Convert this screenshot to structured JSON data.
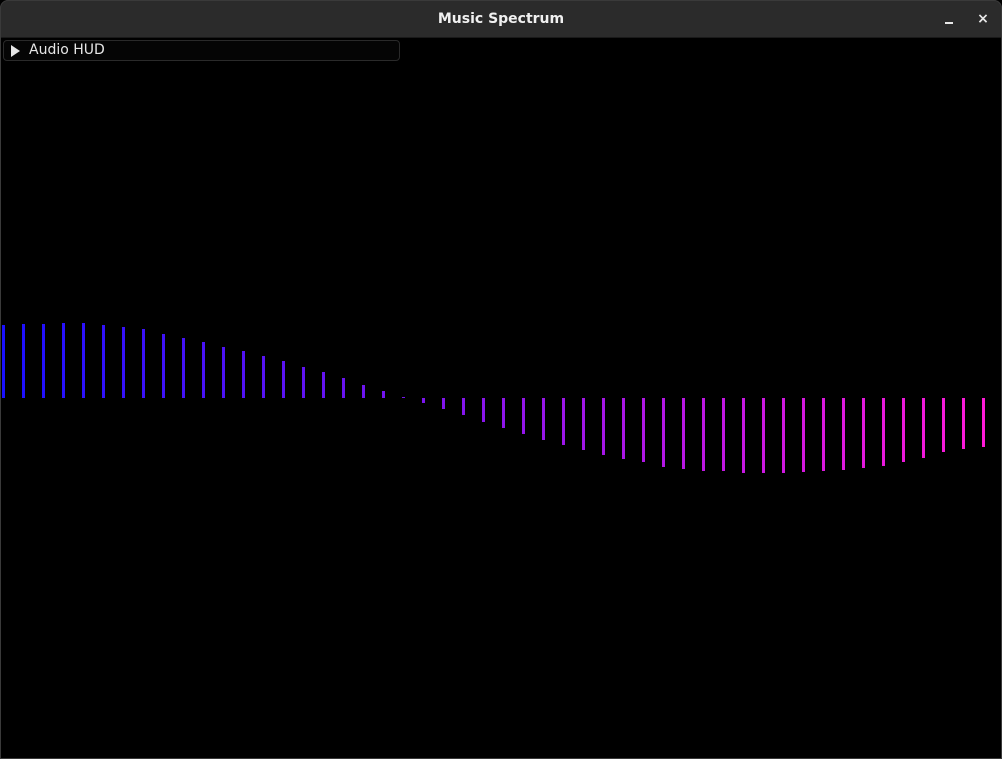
{
  "window": {
    "title": "Music Spectrum",
    "minimize_glyph": "minimize-icon",
    "close_glyph": "×"
  },
  "hud": {
    "label": "Audio HUD",
    "expand_icon": "play-triangle-icon"
  },
  "spectrum": {
    "colors": {
      "start": "#1a10ff",
      "end": "#ff1ad8"
    },
    "values": [
      73,
      74,
      74,
      75,
      75,
      73,
      71,
      69,
      64,
      60,
      56,
      51,
      47,
      42,
      37,
      31,
      26,
      20,
      13,
      7,
      1,
      -5,
      -11,
      -17,
      -24,
      -30,
      -36,
      -42,
      -47,
      -52,
      -57,
      -61,
      -64,
      -69,
      -71,
      -73,
      -73,
      -75,
      -75,
      -75,
      -74,
      -73,
      -72,
      -70,
      -68,
      -64,
      -60,
      -54,
      -51,
      -49
    ]
  }
}
